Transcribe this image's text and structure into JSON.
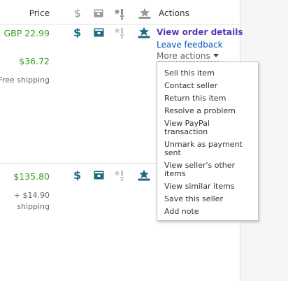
{
  "header": {
    "price_label": "Price",
    "actions_label": "Actions",
    "icons": [
      "dollar-icon",
      "package-icon",
      "feedback-star-icon",
      "seller-rating-icon"
    ]
  },
  "orders": [
    {
      "price": "GBP 22.99",
      "converted_price": "$36.72",
      "shipping": "Free shipping",
      "actions": {
        "primary": "View order details",
        "secondary": "Leave feedback",
        "more": "More actions"
      }
    },
    {
      "price": "$135.80",
      "shipping_cost": "+ $14.90",
      "shipping_label": "shipping"
    }
  ],
  "more_actions_menu": {
    "items": [
      "Sell this item",
      "Contact seller",
      "Return this item",
      "Resolve a problem",
      "View PayPal transaction",
      "Unmark as payment sent",
      "View seller's other items",
      "View similar items",
      "Save this seller",
      "Add note"
    ]
  },
  "colors": {
    "teal_icon": "#1e6a82",
    "gray_icon": "#9a9a9a",
    "price_green": "#3a9a1f",
    "link_purple": "#5a38b5",
    "link_blue": "#0654ba"
  }
}
